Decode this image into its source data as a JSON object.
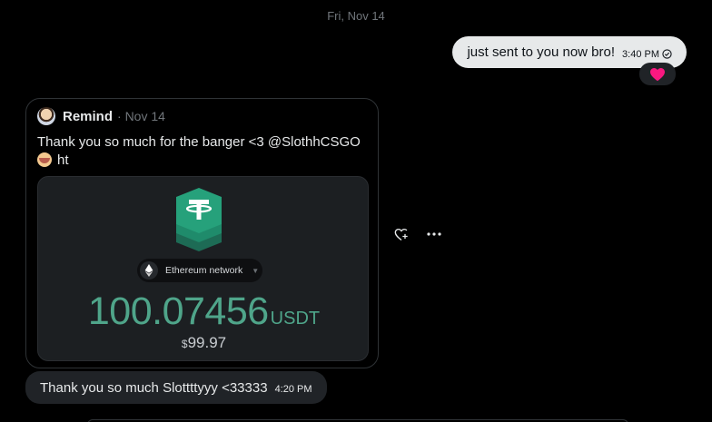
{
  "date_separator": "Fri, Nov 14",
  "outgoing_message": {
    "text": "just sent to you now bro!",
    "time": "3:40 PM",
    "status_icon": "check-circle-icon",
    "reaction": "heart-icon",
    "reaction_color": "#f91880"
  },
  "quoted_post": {
    "author": "Remind",
    "date": "· Nov 14",
    "text_line1": "Thank you so much for the banger <3 @SlothhCSGO",
    "text_line2": "ht",
    "media": {
      "network_label": "Ethereum network",
      "amount": "100.07456",
      "unit": "USDT",
      "usd_symbol": "$",
      "usd_value": "99.97",
      "accent_color": "#4fa58a",
      "token_color": "#26a17b"
    }
  },
  "message_actions": {
    "react": "heart-plus-icon",
    "more": "more-horizontal-icon"
  },
  "incoming_message": {
    "text": "Thank you so much Slottttyyy <33333",
    "time": "4:20 PM"
  }
}
